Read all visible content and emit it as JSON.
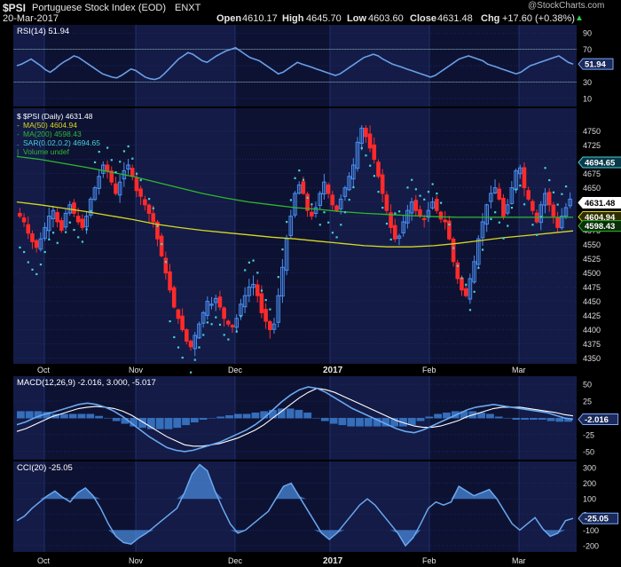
{
  "header": {
    "symbol": "$PSI",
    "name": "Portuguese Stock Index (EOD)",
    "exchange": "ENXT",
    "date": "20-Mar-2017",
    "watermark": "@StockCharts.com",
    "open_label": "Open",
    "open": "4610.17",
    "high_label": "High",
    "high": "4645.70",
    "low_label": "Low",
    "low": "4603.60",
    "close_label": "Close",
    "close": "4631.48",
    "chg_label": "Chg",
    "chg": "+17.60 (+0.38%)",
    "up_arrow": "▲"
  },
  "colors": {
    "background": "#000000",
    "panel_bg": "#0d1233",
    "alt_band": "#1a2256",
    "grid": "#2a3a80",
    "up": "#4a8ef0",
    "down": "#ff2a2a",
    "ma50": "#d8d820",
    "ma200": "#2eb82e",
    "sar": "#48d0d8",
    "rsi": "#6a9fe8",
    "macd": "#6aa8f0",
    "signal": "#ffffff",
    "hist": "#3a78c8",
    "cci": "#6aa8f0"
  },
  "chart_data": [
    {
      "type": "line",
      "panel": "rsi",
      "legend": "RSI(14) 51.94",
      "ylim": [
        0,
        100
      ],
      "yticks": [
        90,
        70,
        50,
        30,
        10
      ],
      "value_tag": "51.94",
      "levels": [
        70,
        30
      ],
      "series": [
        {
          "name": "RSI(14)",
          "values": [
            50,
            52,
            55,
            58,
            54,
            50,
            45,
            42,
            46,
            51,
            55,
            58,
            62,
            60,
            56,
            52,
            48,
            44,
            40,
            38,
            36,
            35,
            38,
            42,
            46,
            44,
            40,
            36,
            34,
            33,
            35,
            40,
            46,
            52,
            58,
            62,
            66,
            64,
            60,
            56,
            54,
            58,
            62,
            65,
            68,
            70,
            72,
            68,
            64,
            60,
            58,
            56,
            52,
            48,
            44,
            40,
            42,
            46,
            50,
            54,
            52,
            50,
            48,
            46,
            44,
            42,
            40,
            38,
            40,
            44,
            48,
            52,
            56,
            60,
            62,
            64,
            62,
            58,
            55,
            52,
            50,
            48,
            46,
            44,
            42,
            40,
            38,
            36,
            38,
            42,
            46,
            50,
            54,
            58,
            60,
            62,
            60,
            58,
            56,
            52,
            50,
            48,
            46,
            44,
            42,
            40,
            42,
            46,
            50,
            52,
            54,
            56,
            58,
            60,
            62,
            58,
            54,
            52
          ]
        }
      ]
    },
    {
      "type": "candlestick",
      "panel": "price",
      "legend": [
        "$PSI (Daily) 4631.48",
        "MA(50) 4604.94",
        "MA(200) 4598.43",
        "SAR(0.02,0.2) 4694.65",
        "Volume undef"
      ],
      "ylim": [
        4340,
        4790
      ],
      "yticks": [
        4750,
        4725,
        4700,
        4675,
        4650,
        4625,
        4600,
        4575,
        4550,
        4525,
        4500,
        4475,
        4450,
        4425,
        4400,
        4375,
        4350
      ],
      "value_tags": [
        "4694.65",
        "4631.48",
        "4604.94",
        "4598.43"
      ],
      "x_labels": [
        "Oct",
        "Nov",
        "Dec",
        "2017",
        "Feb",
        "Mar"
      ],
      "ohlc_anchor_close": [
        4600,
        4590,
        4570,
        4555,
        4545,
        4560,
        4580,
        4600,
        4610,
        4590,
        4575,
        4605,
        4620,
        4605,
        4590,
        4580,
        4600,
        4630,
        4650,
        4670,
        4690,
        4680,
        4660,
        4640,
        4660,
        4680,
        4690,
        4670,
        4645,
        4635,
        4620,
        4605,
        4590,
        4560,
        4530,
        4500,
        4470,
        4440,
        4420,
        4400,
        4380,
        4370,
        4390,
        4410,
        4430,
        4450,
        4445,
        4455,
        4440,
        4420,
        4410,
        4405,
        4420,
        4445,
        4460,
        4475,
        4480,
        4460,
        4430,
        4415,
        4400,
        4410,
        4460,
        4510,
        4560,
        4600,
        4640,
        4655,
        4640,
        4610,
        4600,
        4615,
        4640,
        4660,
        4640,
        4620,
        4610,
        4630,
        4650,
        4670,
        4690,
        4730,
        4755,
        4740,
        4720,
        4700,
        4670,
        4640,
        4610,
        4580,
        4560,
        4565,
        4590,
        4610,
        4625,
        4610,
        4600,
        4595,
        4610,
        4625,
        4610,
        4595,
        4590,
        4560,
        4520,
        4490,
        4470,
        4460,
        4490,
        4520,
        4560,
        4590,
        4620,
        4640,
        4650,
        4630,
        4600,
        4620,
        4650,
        4680,
        4685,
        4650,
        4630,
        4610,
        4590,
        4620,
        4640,
        4620,
        4600,
        4580,
        4600,
        4615,
        4630
      ],
      "ma50": [
        4625,
        4620,
        4614,
        4608,
        4601,
        4594,
        4586,
        4580,
        4575,
        4571,
        4567,
        4563,
        4560,
        4556,
        4552,
        4548,
        4546,
        4546,
        4548,
        4552,
        4557,
        4562,
        4566,
        4570,
        4574
      ],
      "ma200": [
        4705,
        4700,
        4693,
        4686,
        4678,
        4670,
        4660,
        4650,
        4640,
        4632,
        4625,
        4620,
        4615,
        4612,
        4608,
        4605,
        4603,
        4601,
        4599,
        4598,
        4598,
        4598,
        4598,
        4598,
        4598
      ],
      "sar_dots": 120
    },
    {
      "type": "line",
      "panel": "macd",
      "legend": "MACD(12,26,9) -2.016, 3.000, -5.017",
      "ylim": [
        -62,
        62
      ],
      "yticks": [
        50,
        25,
        0,
        -25,
        -50
      ],
      "value_tag": "-2.016",
      "series": [
        {
          "name": "MACD",
          "values": [
            -10,
            -6,
            0,
            5,
            8,
            12,
            16,
            20,
            22,
            20,
            16,
            10,
            2,
            -8,
            -18,
            -28,
            -36,
            -44,
            -48,
            -50,
            -48,
            -44,
            -40,
            -36,
            -30,
            -24,
            -18,
            -10,
            0,
            12,
            24,
            34,
            42,
            46,
            44,
            38,
            30,
            22,
            14,
            8,
            2,
            -4,
            -10,
            -16,
            -20,
            -22,
            -18,
            -12,
            -6,
            0,
            6,
            12,
            16,
            18,
            20,
            18,
            16,
            14,
            12,
            10,
            8,
            4,
            0,
            -2
          ]
        },
        {
          "name": "Signal",
          "values": [
            -20,
            -16,
            -10,
            -4,
            2,
            6,
            10,
            14,
            16,
            17,
            16,
            14,
            10,
            4,
            -4,
            -12,
            -20,
            -28,
            -34,
            -40,
            -42,
            -42,
            -40,
            -38,
            -34,
            -30,
            -24,
            -18,
            -10,
            0,
            10,
            20,
            30,
            38,
            44,
            42,
            38,
            32,
            26,
            20,
            14,
            8,
            2,
            -4,
            -8,
            -12,
            -14,
            -14,
            -12,
            -8,
            -4,
            2,
            6,
            10,
            14,
            16,
            16,
            16,
            14,
            12,
            10,
            8,
            5,
            3
          ]
        }
      ]
    },
    {
      "type": "line",
      "panel": "cci",
      "legend": "CCI(20) -25.05",
      "ylim": [
        -240,
        340
      ],
      "yticks": [
        300,
        200,
        100,
        0,
        -100,
        -200
      ],
      "value_tag": "-25.05",
      "series": [
        {
          "name": "CCI(20)",
          "values": [
            -40,
            -10,
            40,
            80,
            120,
            150,
            110,
            80,
            140,
            170,
            120,
            40,
            -60,
            -140,
            -180,
            -190,
            -150,
            -120,
            -80,
            -40,
            0,
            40,
            140,
            260,
            320,
            280,
            150,
            40,
            -60,
            -120,
            -100,
            -60,
            -20,
            20,
            100,
            180,
            200,
            120,
            40,
            -40,
            -120,
            -160,
            -120,
            -60,
            0,
            60,
            100,
            60,
            0,
            -60,
            -120,
            -200,
            -150,
            -60,
            40,
            80,
            60,
            80,
            180,
            150,
            120,
            140,
            160,
            100,
            20,
            -60,
            -100,
            -60,
            -20,
            -90,
            -140,
            -120,
            -40,
            -25
          ]
        }
      ]
    }
  ]
}
